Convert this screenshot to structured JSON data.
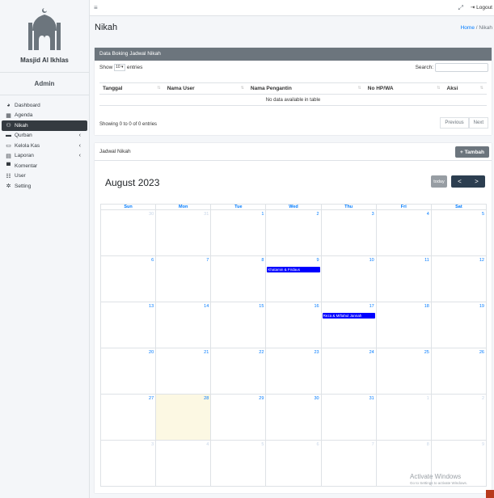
{
  "sidebar": {
    "brand_name": "Masjid Al Ikhlas",
    "user_name": "Admin",
    "items": [
      {
        "label": "Dashboard",
        "icon": "dashboard-icon"
      },
      {
        "label": "Agenda",
        "icon": "calendar-icon"
      },
      {
        "label": "Nikah",
        "icon": "couple-icon",
        "active": true
      },
      {
        "label": "Qurban",
        "icon": "box-icon",
        "has_children": true
      },
      {
        "label": "Kelola Kas",
        "icon": "money-icon",
        "has_children": true
      },
      {
        "label": "Laporan",
        "icon": "report-icon",
        "has_children": true
      },
      {
        "label": "Komentar",
        "icon": "comment-icon"
      },
      {
        "label": "User",
        "icon": "users-icon"
      },
      {
        "label": "Setting",
        "icon": "gear-icon"
      }
    ]
  },
  "topbar": {
    "logout_label": "Logout"
  },
  "header": {
    "title": "Nikah",
    "breadcrumb_home": "Home",
    "breadcrumb_sep": "/",
    "breadcrumb_current": "Nikah"
  },
  "booking_card": {
    "title": "Data Boking Jadwal Nikah",
    "show_label": "Show",
    "entries_value": "10",
    "entries_label": "entries",
    "search_label": "Search:",
    "columns": [
      "Tanggal",
      "Nama User",
      "Nama Pengantin",
      "No HP/WA",
      "Aksi"
    ],
    "empty_text": "No data available in table",
    "info_text": "Showing 0 to 0 of 0 entries",
    "prev_label": "Previous",
    "next_label": "Next"
  },
  "schedule_card": {
    "title": "Jadwal Nikah",
    "add_label": "+ Tambah",
    "calendar_title": "August 2023",
    "today_label": "today",
    "prev_icon": "<",
    "next_icon": ">",
    "weekdays": [
      "Sun",
      "Mon",
      "Tue",
      "Wed",
      "Thu",
      "Fri",
      "Sat"
    ],
    "weeks": [
      [
        {
          "d": "30",
          "other": true
        },
        {
          "d": "31",
          "other": true
        },
        {
          "d": "1"
        },
        {
          "d": "2"
        },
        {
          "d": "3"
        },
        {
          "d": "4"
        },
        {
          "d": "5"
        }
      ],
      [
        {
          "d": "6"
        },
        {
          "d": "7"
        },
        {
          "d": "8"
        },
        {
          "d": "9",
          "event": "Khatamin & Firdaus"
        },
        {
          "d": "10"
        },
        {
          "d": "11"
        },
        {
          "d": "12"
        }
      ],
      [
        {
          "d": "13"
        },
        {
          "d": "14"
        },
        {
          "d": "15"
        },
        {
          "d": "16"
        },
        {
          "d": "17",
          "event": "Reza & Miftahul Jannah"
        },
        {
          "d": "18"
        },
        {
          "d": "19"
        }
      ],
      [
        {
          "d": "20"
        },
        {
          "d": "21"
        },
        {
          "d": "22"
        },
        {
          "d": "23"
        },
        {
          "d": "24"
        },
        {
          "d": "25"
        },
        {
          "d": "26"
        }
      ],
      [
        {
          "d": "27"
        },
        {
          "d": "28",
          "today": true
        },
        {
          "d": "29"
        },
        {
          "d": "30"
        },
        {
          "d": "31"
        },
        {
          "d": "1",
          "other": true
        },
        {
          "d": "2",
          "other": true
        }
      ],
      [
        {
          "d": "3",
          "other": true
        },
        {
          "d": "4",
          "other": true
        },
        {
          "d": "5",
          "other": true
        },
        {
          "d": "6",
          "other": true
        },
        {
          "d": "7",
          "other": true
        },
        {
          "d": "8",
          "other": true
        },
        {
          "d": "9",
          "other": true
        }
      ]
    ],
    "event_color": "#0000ff"
  },
  "watermark": {
    "line1": "Activate Windows",
    "line2": "Go to Settings to activate Windows."
  }
}
